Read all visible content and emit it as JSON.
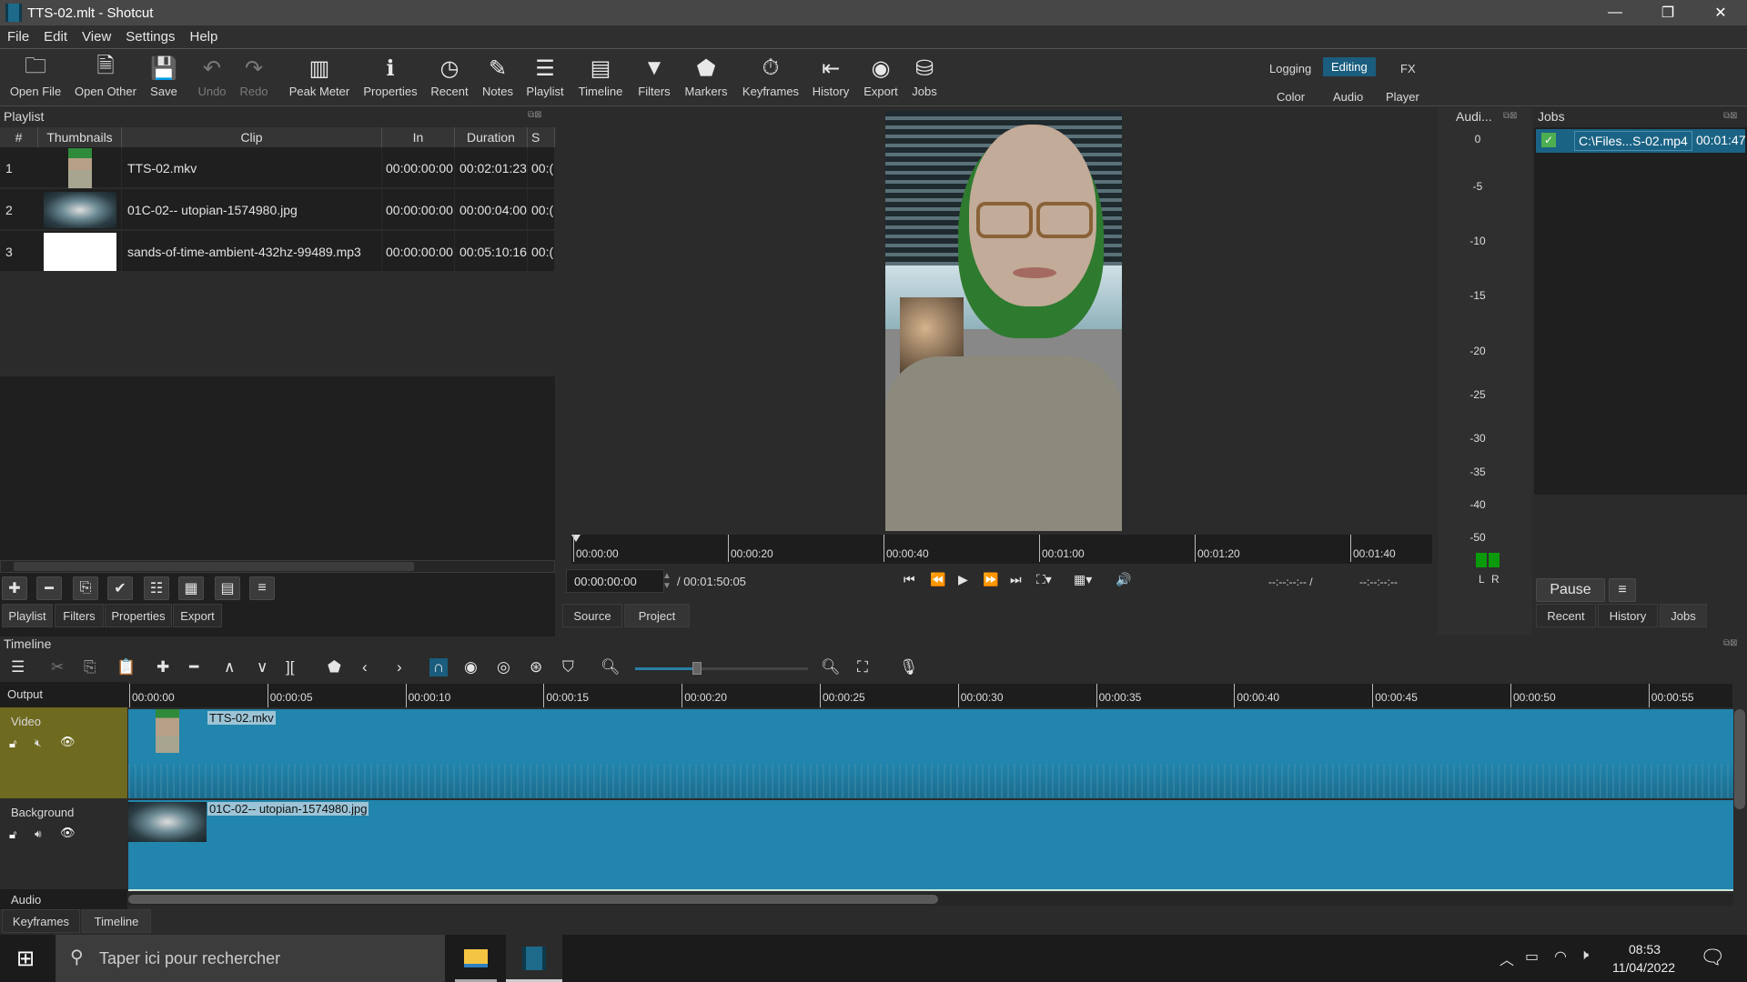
{
  "window": {
    "title": "TTS-02.mlt - Shotcut",
    "controls": {
      "minimize": "—",
      "maximize": "❐",
      "close": "✕"
    }
  },
  "menu": [
    "File",
    "Edit",
    "View",
    "Settings",
    "Help"
  ],
  "toolbar": {
    "buttons": [
      {
        "label": "Open File",
        "icon": "open-folder-icon",
        "glyph": "🗀"
      },
      {
        "label": "Open Other",
        "icon": "open-other-icon",
        "glyph": "🗎"
      },
      {
        "label": "Save",
        "icon": "save-icon",
        "glyph": "💾"
      },
      {
        "label": "Undo",
        "icon": "undo-icon",
        "glyph": "↶",
        "disabled": true
      },
      {
        "label": "Redo",
        "icon": "redo-icon",
        "glyph": "↷",
        "disabled": true
      },
      {
        "label": "Peak Meter",
        "icon": "peak-meter-icon",
        "glyph": "▥"
      },
      {
        "label": "Properties",
        "icon": "info-icon",
        "glyph": "ℹ"
      },
      {
        "label": "Recent",
        "icon": "clock-icon",
        "glyph": "◷"
      },
      {
        "label": "Notes",
        "icon": "notes-icon",
        "glyph": "✎"
      },
      {
        "label": "Playlist",
        "icon": "list-icon",
        "glyph": "☰"
      },
      {
        "label": "Timeline",
        "icon": "timeline-icon",
        "glyph": "▤"
      },
      {
        "label": "Filters",
        "icon": "filter-icon",
        "glyph": "▼"
      },
      {
        "label": "Markers",
        "icon": "marker-icon",
        "glyph": "⬟"
      },
      {
        "label": "Keyframes",
        "icon": "stopwatch-icon",
        "glyph": "⏱"
      },
      {
        "label": "History",
        "icon": "history-icon",
        "glyph": "⇤"
      },
      {
        "label": "Export",
        "icon": "disc-icon",
        "glyph": "◉"
      },
      {
        "label": "Jobs",
        "icon": "database-icon",
        "glyph": "⛁"
      }
    ],
    "layouts": {
      "row1": [
        "Logging",
        "Editing",
        "FX"
      ],
      "row2": [
        "Color",
        "Audio",
        "Player"
      ],
      "active": "Editing"
    }
  },
  "playlist": {
    "title": "Playlist",
    "columns": [
      "#",
      "Thumbnails",
      "Clip",
      "In",
      "Duration",
      "S"
    ],
    "rows": [
      {
        "num": "1",
        "clip": "TTS-02.mkv",
        "in": "00:00:00:00",
        "duration": "00:02:01:23",
        "start": "00:("
      },
      {
        "num": "2",
        "clip": "01C-02-- utopian-1574980.jpg",
        "in": "00:00:00:00",
        "duration": "00:00:04:00",
        "start": "00:("
      },
      {
        "num": "3",
        "clip": "sands-of-time-ambient-432hz-99489.mp3",
        "in": "00:00:00:00",
        "duration": "00:05:10:16",
        "start": "00:("
      }
    ],
    "buttons": [
      "add-icon",
      "remove-icon",
      "update-icon",
      "check-icon",
      "details-view-icon",
      "tiles-view-icon",
      "icons-view-icon",
      "menu-icon"
    ],
    "tabs": [
      "Playlist",
      "Filters",
      "Properties",
      "Export"
    ],
    "active_tab": "Playlist"
  },
  "viewer": {
    "ruler_labels": [
      "00:00:00",
      "00:00:20",
      "00:00:40",
      "00:01:00",
      "00:01:20",
      "00:01:40"
    ],
    "current_time": "00:00:00:00",
    "total_duration": "/ 00:01:50:05",
    "in_point": "--:--:--:-- /",
    "out_point": "--:--:--:--",
    "tabs": [
      "Source",
      "Project"
    ],
    "active_tab": "Project"
  },
  "audio_meter": {
    "title": "Audi...",
    "scale": [
      "0",
      "-5",
      "-10",
      "-15",
      "-20",
      "-25",
      "-30",
      "-35",
      "-40",
      "-50"
    ],
    "channels": [
      "L",
      "R"
    ],
    "color": "#0a9a0a"
  },
  "jobs": {
    "title": "Jobs",
    "items": [
      {
        "name": "C:\\Files...S-02.mp4",
        "time": "00:01:47",
        "status": "done"
      }
    ],
    "pause_label": "Pause",
    "tabs": [
      "Recent",
      "History",
      "Jobs"
    ],
    "active_tab": "Jobs"
  },
  "timeline": {
    "title": "Timeline",
    "ruler_labels": [
      "00:00:00",
      "00:00:05",
      "00:00:10",
      "00:00:15",
      "00:00:20",
      "00:00:25",
      "00:00:30",
      "00:00:35",
      "00:00:40",
      "00:00:45",
      "00:00:50",
      "00:00:55"
    ],
    "zoom_level": 0.36,
    "tracks": [
      {
        "name": "Output"
      },
      {
        "name": "Video",
        "clip": "TTS-02.mkv",
        "selected": true
      },
      {
        "name": "Background",
        "clip": "01C-02-- utopian-1574980.jpg"
      },
      {
        "name": "Audio"
      }
    ],
    "tabs": [
      "Keyframes",
      "Timeline"
    ],
    "active_tab": "Timeline"
  },
  "taskbar": {
    "search_placeholder": "Taper ici pour rechercher",
    "time": "08:53",
    "date": "11/04/2022"
  },
  "colors": {
    "accent": "#1a5d7e",
    "clip": "#2185ad",
    "selected_track": "#6e6a20"
  }
}
